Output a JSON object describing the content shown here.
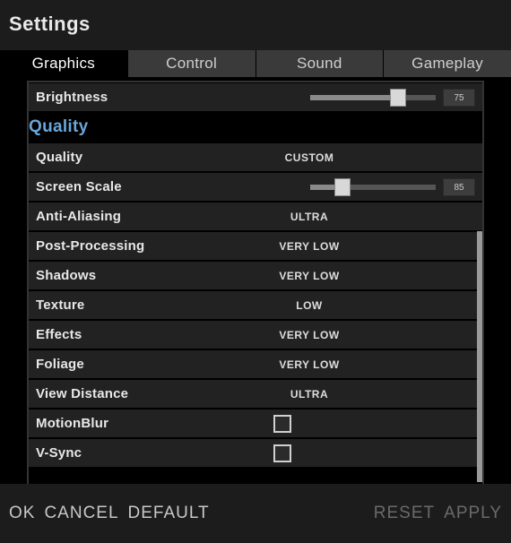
{
  "header": {
    "title": "Settings"
  },
  "tabs": [
    {
      "label": "Graphics",
      "active": true
    },
    {
      "label": "Control",
      "active": false
    },
    {
      "label": "Sound",
      "active": false
    },
    {
      "label": "Gameplay",
      "active": false
    }
  ],
  "section": {
    "quality_title": "Quality"
  },
  "rows": {
    "brightness": {
      "label": "Brightness",
      "value": 75,
      "max": 100
    },
    "quality": {
      "label": "Quality",
      "value": "CUSTOM"
    },
    "screen_scale": {
      "label": "Screen Scale",
      "value": 85,
      "max": 400
    },
    "anti_aliasing": {
      "label": "Anti-Aliasing",
      "value": "ULTRA"
    },
    "post_processing": {
      "label": "Post-Processing",
      "value": "VERY LOW"
    },
    "shadows": {
      "label": "Shadows",
      "value": "VERY LOW"
    },
    "texture": {
      "label": "Texture",
      "value": "LOW"
    },
    "effects": {
      "label": "Effects",
      "value": "VERY LOW"
    },
    "foliage": {
      "label": "Foliage",
      "value": "VERY LOW"
    },
    "view_distance": {
      "label": "View Distance",
      "value": "ULTRA"
    },
    "motion_blur": {
      "label": "MotionBlur",
      "checked": false
    },
    "v_sync": {
      "label": "V-Sync",
      "checked": false
    }
  },
  "footer": {
    "ok": "OK",
    "cancel": "CANCEL",
    "default": "DEFAULT",
    "reset": "RESET",
    "apply": "APPLY"
  }
}
